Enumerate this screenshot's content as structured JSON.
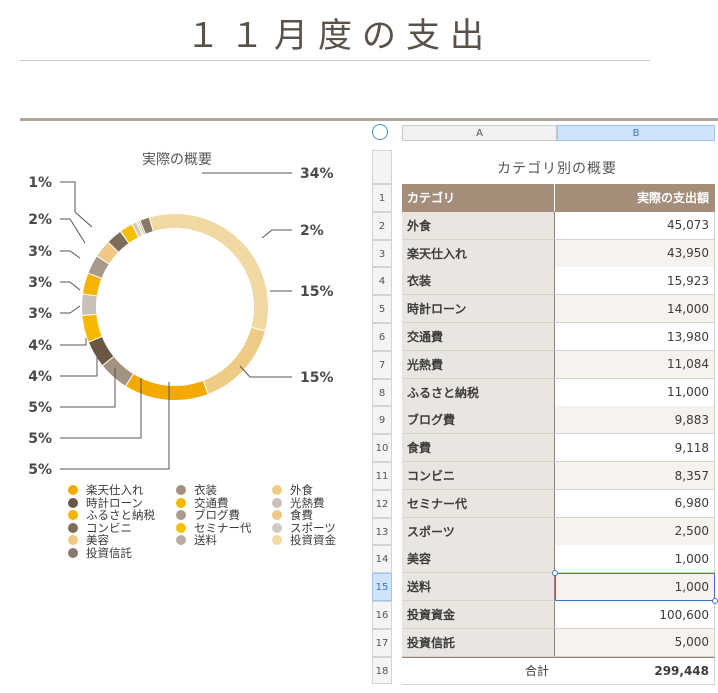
{
  "page": {
    "title": "１１月度の支出"
  },
  "chart_data": {
    "type": "pie",
    "title": "実際の概要",
    "categories": [
      "投資資金",
      "外食",
      "楽天仕入れ",
      "衣装",
      "時計ローン",
      "交通費",
      "光熱費",
      "ふるさと納税",
      "ブログ費",
      "食費",
      "コンビニ",
      "セミナー代",
      "スポーツ",
      "美容",
      "送料",
      "投資信託"
    ],
    "values": [
      100600,
      45073,
      43950,
      15923,
      14000,
      13980,
      11084,
      11000,
      9883,
      9118,
      8357,
      6980,
      2500,
      1000,
      1000,
      5000
    ],
    "percent_labels": [
      "34%",
      "2%",
      "15%",
      "15%",
      "5%",
      "5%",
      "5%",
      "4%",
      "4%",
      "3%",
      "3%",
      "3%",
      "2%",
      "1%"
    ],
    "colors": {
      "投資資金": "#f1d9a4",
      "投資信託": "#8a7868",
      "楽天仕入れ": "#f4a900",
      "衣装": "#a39280",
      "時計ローン": "#6b5744",
      "外食": "#efcc86",
      "交通費": "#f6b900",
      "光熱費": "#c9c0b7",
      "ふるさと納税": "#f6b400",
      "ブログ費": "#a8998b",
      "食費": "#f0c886",
      "コンビニ": "#7f6b59",
      "セミナー代": "#f5c000",
      "スポーツ": "#d3cbc2",
      "美容": "#f2c880",
      "送料": "#b9ada1"
    },
    "legend_position": "bottom"
  },
  "legend": [
    {
      "label": "楽天仕入れ",
      "color": "#f4a900"
    },
    {
      "label": "時計ローン",
      "color": "#6b5744"
    },
    {
      "label": "ふるさと納税",
      "color": "#f6b400"
    },
    {
      "label": "コンビニ",
      "color": "#7f6b59"
    },
    {
      "label": "美容",
      "color": "#f2c880"
    },
    {
      "label": "投資信託",
      "color": "#8a7868"
    },
    {
      "label": "衣装",
      "color": "#a39280"
    },
    {
      "label": "交通費",
      "color": "#f6b900"
    },
    {
      "label": "ブログ費",
      "color": "#a8998b"
    },
    {
      "label": "セミナー代",
      "color": "#f5c000"
    },
    {
      "label": "送料",
      "color": "#b9ada1"
    },
    {
      "label": "外食",
      "color": "#efcc86"
    },
    {
      "label": "光熱費",
      "color": "#c9c0b7"
    },
    {
      "label": "食費",
      "color": "#f0c886"
    },
    {
      "label": "スポーツ",
      "color": "#d3cbc2"
    },
    {
      "label": "投資資金",
      "color": "#f1d9a4"
    }
  ],
  "sheet": {
    "columns": [
      "A",
      "B"
    ],
    "selected_column": "B",
    "title": "カテゴリ別の概要",
    "header": {
      "a": "カテゴリ",
      "b": "実際の支出額"
    },
    "rows": [
      {
        "a": "外食",
        "b": "45,073"
      },
      {
        "a": "楽天仕入れ",
        "b": "43,950"
      },
      {
        "a": "衣装",
        "b": "15,923"
      },
      {
        "a": "時計ローン",
        "b": "14,000"
      },
      {
        "a": "交通費",
        "b": "13,980"
      },
      {
        "a": "光熱費",
        "b": "11,084"
      },
      {
        "a": "ふるさと納税",
        "b": "11,000"
      },
      {
        "a": "ブログ費",
        "b": "9,883"
      },
      {
        "a": "食費",
        "b": "9,118"
      },
      {
        "a": "コンビニ",
        "b": "8,357"
      },
      {
        "a": "セミナー代",
        "b": "6,980"
      },
      {
        "a": "スポーツ",
        "b": "2,500"
      },
      {
        "a": "美容",
        "b": "1,000"
      },
      {
        "a": "送料",
        "b": "1,000"
      },
      {
        "a": "投資資金",
        "b": "100,600"
      },
      {
        "a": "投資信託",
        "b": "5,000"
      }
    ],
    "total": {
      "a": "合計",
      "b": "299,448"
    },
    "row_numbers": [
      "1",
      "2",
      "3",
      "4",
      "5",
      "6",
      "7",
      "8",
      "9",
      "10",
      "11",
      "12",
      "13",
      "14",
      "15",
      "16",
      "17",
      "18"
    ],
    "selected_row": "15"
  }
}
